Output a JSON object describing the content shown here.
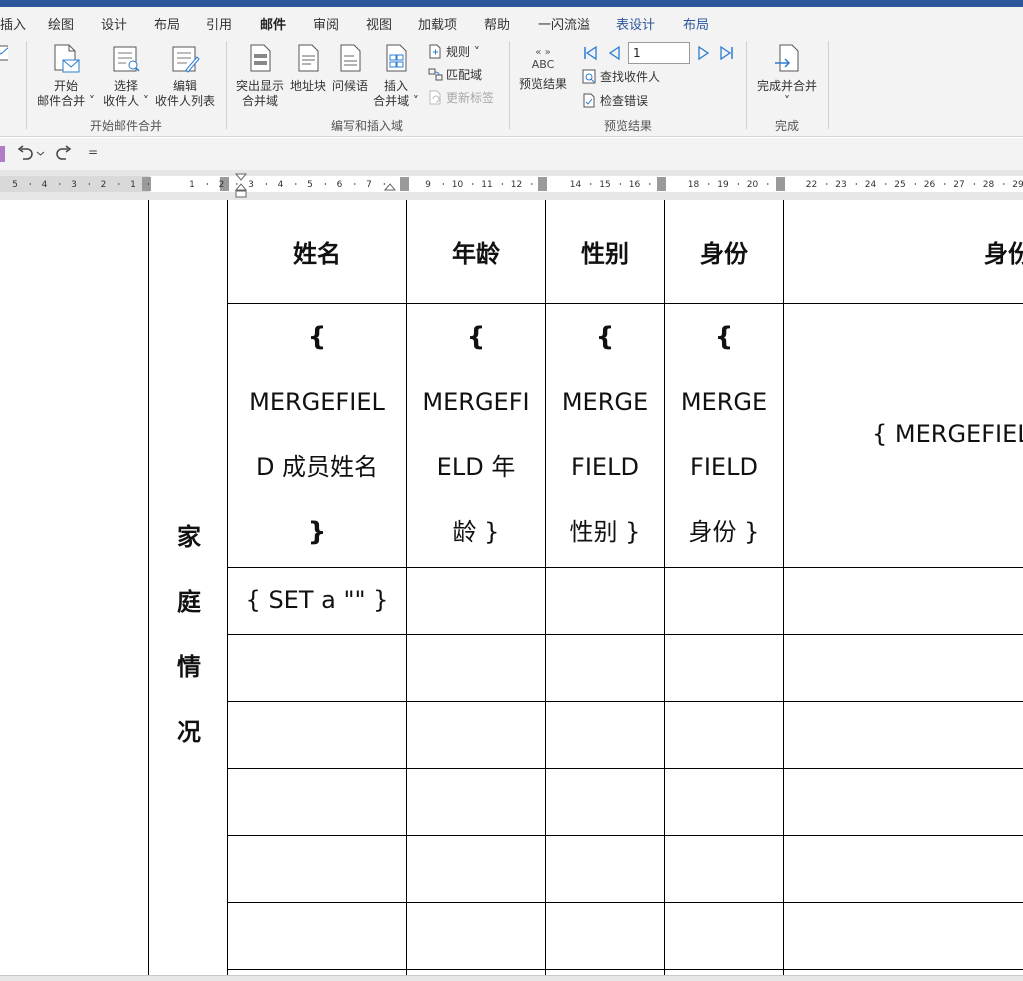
{
  "tabs": [
    "插入",
    "绘图",
    "设计",
    "布局",
    "引用",
    "邮件",
    "审阅",
    "视图",
    "加载项",
    "帮助",
    "一闪流溢",
    "表设计",
    "布局"
  ],
  "active_tab": "邮件",
  "ribbon": {
    "start_merge": {
      "line1": "开始",
      "line2": "邮件合并 ˅"
    },
    "select_recipients": {
      "line1": "选择",
      "line2": "收件人 ˅"
    },
    "edit_recipients": {
      "line1": "编辑",
      "line2": "收件人列表"
    },
    "group_start": "开始邮件合并",
    "highlight_fields": {
      "line1": "突出显示",
      "line2": "合并域"
    },
    "address_block": "地址块",
    "greeting_line": "问候语",
    "insert_field": {
      "line1": "插入",
      "line2": "合并域 ˅"
    },
    "rules": "规则 ˅",
    "match_fields": "匹配域",
    "update_labels": "更新标签",
    "group_write": "编写和插入域",
    "preview_results": "预览结果",
    "preview_abc": "ABC",
    "record": "1",
    "find_recipient": "查找收件人",
    "check_errors": "检查错误",
    "group_preview": "预览结果",
    "finish_merge": {
      "line1": "完成并合并",
      "line2": "˅"
    },
    "group_finish": "完成"
  },
  "qat": {
    "customize": "="
  },
  "ruler_numbers": {
    "left": [
      "5",
      "4",
      "3",
      "2",
      "1"
    ],
    "right": [
      "1",
      "2",
      "3",
      "4",
      "5",
      "6",
      "7",
      "9",
      "10",
      "11",
      "12",
      "14",
      "15",
      "16",
      "18",
      "19",
      "20",
      "22",
      "23",
      "24",
      "25",
      "26",
      "27",
      "28",
      "29"
    ]
  },
  "table": {
    "side_label": [
      "家",
      "庭",
      "情",
      "况"
    ],
    "headers": [
      "姓名",
      "年龄",
      "性别",
      "身份",
      "身份"
    ],
    "merge_row": [
      [
        "{",
        "MERGEFIEL",
        "D  成员姓名",
        "}"
      ],
      [
        "{",
        "MERGEFI",
        "ELD  年",
        "龄 }"
      ],
      [
        "{",
        "MERGE",
        "FIELD",
        "性别 }"
      ],
      [
        "{",
        "MERGE",
        "FIELD",
        "身份 }"
      ],
      [
        "{  MERGEFIEL"
      ]
    ],
    "set_row": "{  SET a \"\"  }"
  }
}
